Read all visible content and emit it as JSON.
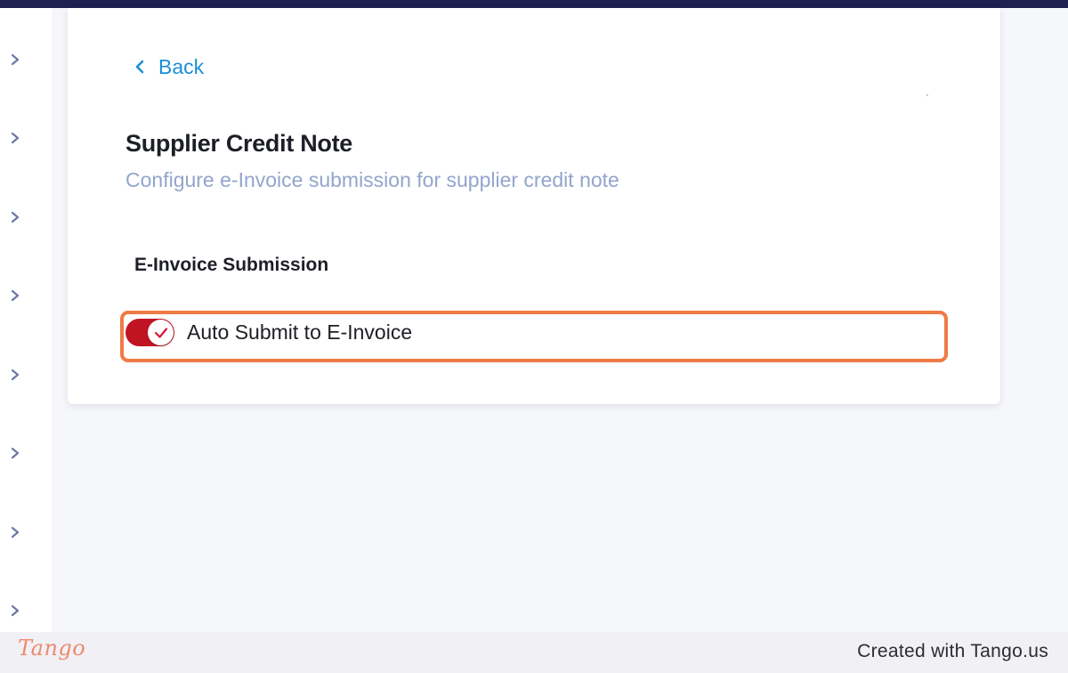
{
  "sidebar": {
    "items": [
      {
        "icon": "chevron-right-icon"
      },
      {
        "icon": "chevron-right-icon"
      },
      {
        "icon": "chevron-right-icon"
      },
      {
        "icon": "chevron-right-icon"
      },
      {
        "icon": "chevron-right-icon"
      },
      {
        "icon": "chevron-right-icon"
      },
      {
        "icon": "chevron-right-icon"
      },
      {
        "icon": "chevron-right-icon"
      }
    ]
  },
  "back": {
    "label": "Back",
    "icon": "chevron-left-icon"
  },
  "page": {
    "title": "Supplier Credit Note",
    "subtitle": "Configure e-Invoice submission for supplier credit note"
  },
  "section": {
    "title": "E-Invoice Submission",
    "toggle": {
      "label": "Auto Submit to E-Invoice",
      "checked": true,
      "icon": "check-icon"
    }
  },
  "footer": {
    "logo": "Tango",
    "text": "Created with Tango.us"
  },
  "colors": {
    "accent": "#1c8fd6",
    "toggle_on": "#c01423",
    "highlight": "#f07a45",
    "top_bar": "#1e2052",
    "subtitle": "#93a5cc"
  }
}
